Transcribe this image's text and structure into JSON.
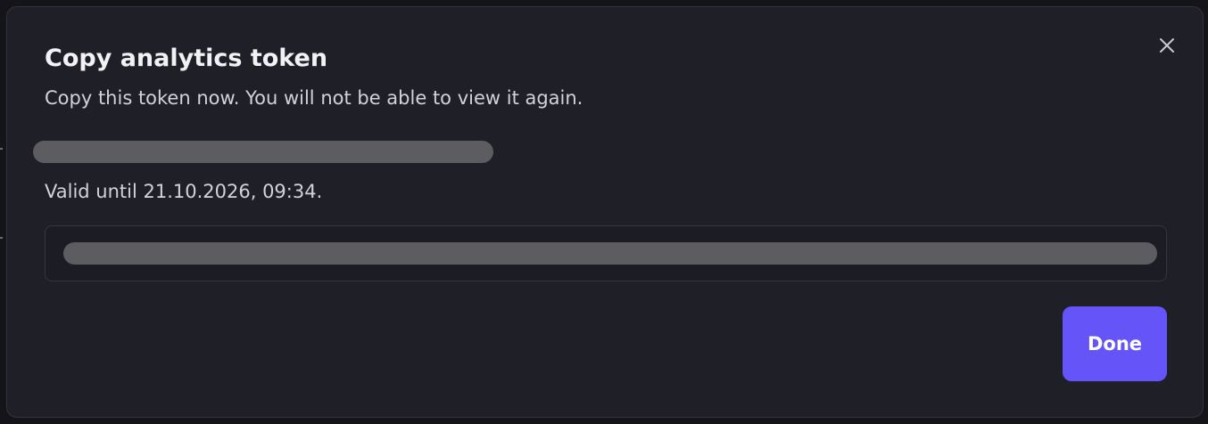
{
  "dialog": {
    "title": "Copy analytics token",
    "subtitle": "Copy this token now. You will not be able to view it again.",
    "token_name": "",
    "valid_until": "Valid until 21.10.2026, 09:34.",
    "token_value": "",
    "done_label": "Done",
    "close_icon": "close-icon"
  },
  "colors": {
    "background": "#1f1f28",
    "primary_button": "#6554f7",
    "redaction": "#5d5d61"
  }
}
